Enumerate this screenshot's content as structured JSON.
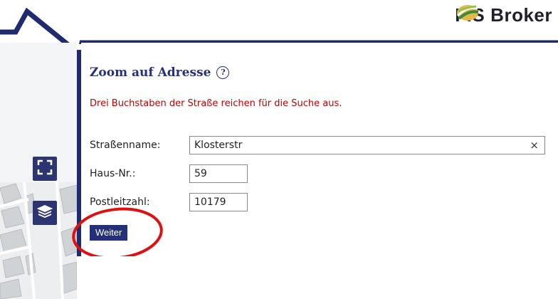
{
  "header": {
    "logo_left": "FIS",
    "logo_right": "Broker",
    "logo_mark": "fis-broker-logo-icon"
  },
  "panel": {
    "title": "Zoom auf Adresse",
    "help_icon": "help-circle-icon",
    "help_symbol": "?",
    "hint": "Drei Buchstaben der Straße reichen für die Suche aus.",
    "fields": {
      "street_label": "Straßenname:",
      "street_value": "Klosterstr",
      "clear_symbol": "×",
      "house_label": "Haus-Nr.:",
      "house_value": "59",
      "zip_label": "Postleitzahl:",
      "zip_value": "10179"
    },
    "submit_label": "Weiter"
  },
  "map_controls": [
    {
      "icon": "fullscreen-icon"
    },
    {
      "icon": "layers-icon"
    }
  ],
  "colors": {
    "accent_navy": "#25307a",
    "hint_red": "#c00000",
    "annotation_red": "#e01010"
  }
}
